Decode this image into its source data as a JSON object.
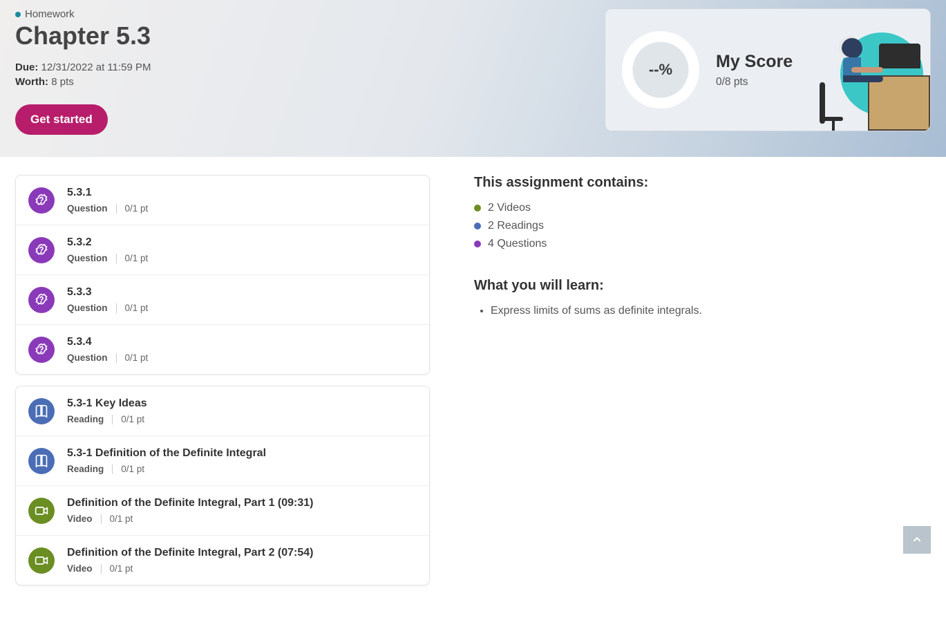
{
  "header": {
    "category": "Homework",
    "title": "Chapter 5.3",
    "due_label": "Due:",
    "due_value": "12/31/2022 at 11:59 PM",
    "worth_label": "Worth:",
    "worth_value": "8 pts",
    "get_started": "Get started"
  },
  "score": {
    "percent": "--%",
    "label": "My Score",
    "pts": "0/8 pts"
  },
  "items_group1": [
    {
      "title": "5.3.1",
      "type": "Question",
      "pts": "0/1 pt",
      "kind": "question"
    },
    {
      "title": "5.3.2",
      "type": "Question",
      "pts": "0/1 pt",
      "kind": "question"
    },
    {
      "title": "5.3.3",
      "type": "Question",
      "pts": "0/1 pt",
      "kind": "question"
    },
    {
      "title": "5.3.4",
      "type": "Question",
      "pts": "0/1 pt",
      "kind": "question"
    }
  ],
  "items_group2": [
    {
      "title": "5.3-1 Key Ideas",
      "type": "Reading",
      "pts": "0/1 pt",
      "kind": "reading"
    },
    {
      "title": "5.3-1 Definition of the Definite Integral",
      "type": "Reading",
      "pts": "0/1 pt",
      "kind": "reading"
    },
    {
      "title": "Definition of the Definite Integral, Part 1 (09:31)",
      "type": "Video",
      "pts": "0/1 pt",
      "kind": "video"
    },
    {
      "title": "Definition of the Definite Integral, Part 2 (07:54)",
      "type": "Video",
      "pts": "0/1 pt",
      "kind": "video"
    }
  ],
  "contains": {
    "heading": "This assignment contains:",
    "items": [
      {
        "label": "2 Videos",
        "color": "olive"
      },
      {
        "label": "2 Readings",
        "color": "blue"
      },
      {
        "label": "4 Questions",
        "color": "purple"
      }
    ]
  },
  "learn": {
    "heading": "What you will learn:",
    "items": [
      "Express limits of sums as definite integrals."
    ]
  }
}
